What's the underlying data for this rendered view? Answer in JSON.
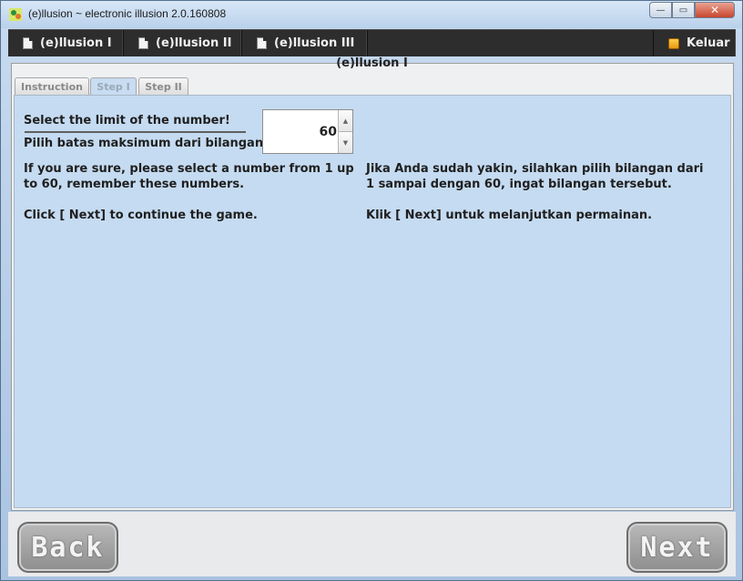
{
  "window": {
    "title": "(e)llusion ~ electronic illusion 2.0.160808",
    "close_label": "✕"
  },
  "menu": {
    "items": [
      {
        "label": "(e)llusion I"
      },
      {
        "label": "(e)llusion II"
      },
      {
        "label": "(e)llusion III"
      }
    ],
    "exit_label": "Keluar"
  },
  "panel": {
    "title": "(e)llusion I"
  },
  "tabs": [
    {
      "label": "Instruction",
      "active": false
    },
    {
      "label": "Step I",
      "active": true
    },
    {
      "label": "Step II",
      "active": false
    }
  ],
  "step": {
    "limit_label_en": "Select the limit of the number!",
    "limit_label_id": "Pilih batas maksimum dari bilangan!",
    "spinner_value": "60",
    "instruction_en_1": "If you are sure, please select a number from 1 up to 60, remember these numbers.",
    "instruction_en_2": "Click [ Next] to continue the game.",
    "instruction_id_1": "Jika Anda sudah yakin, silahkan pilih bilangan dari 1 sampai dengan 60, ingat bilangan tersebut.",
    "instruction_id_2": "Klik [ Next] untuk melanjutkan permainan."
  },
  "buttons": {
    "back_label": "Back",
    "next_label": "Next"
  }
}
